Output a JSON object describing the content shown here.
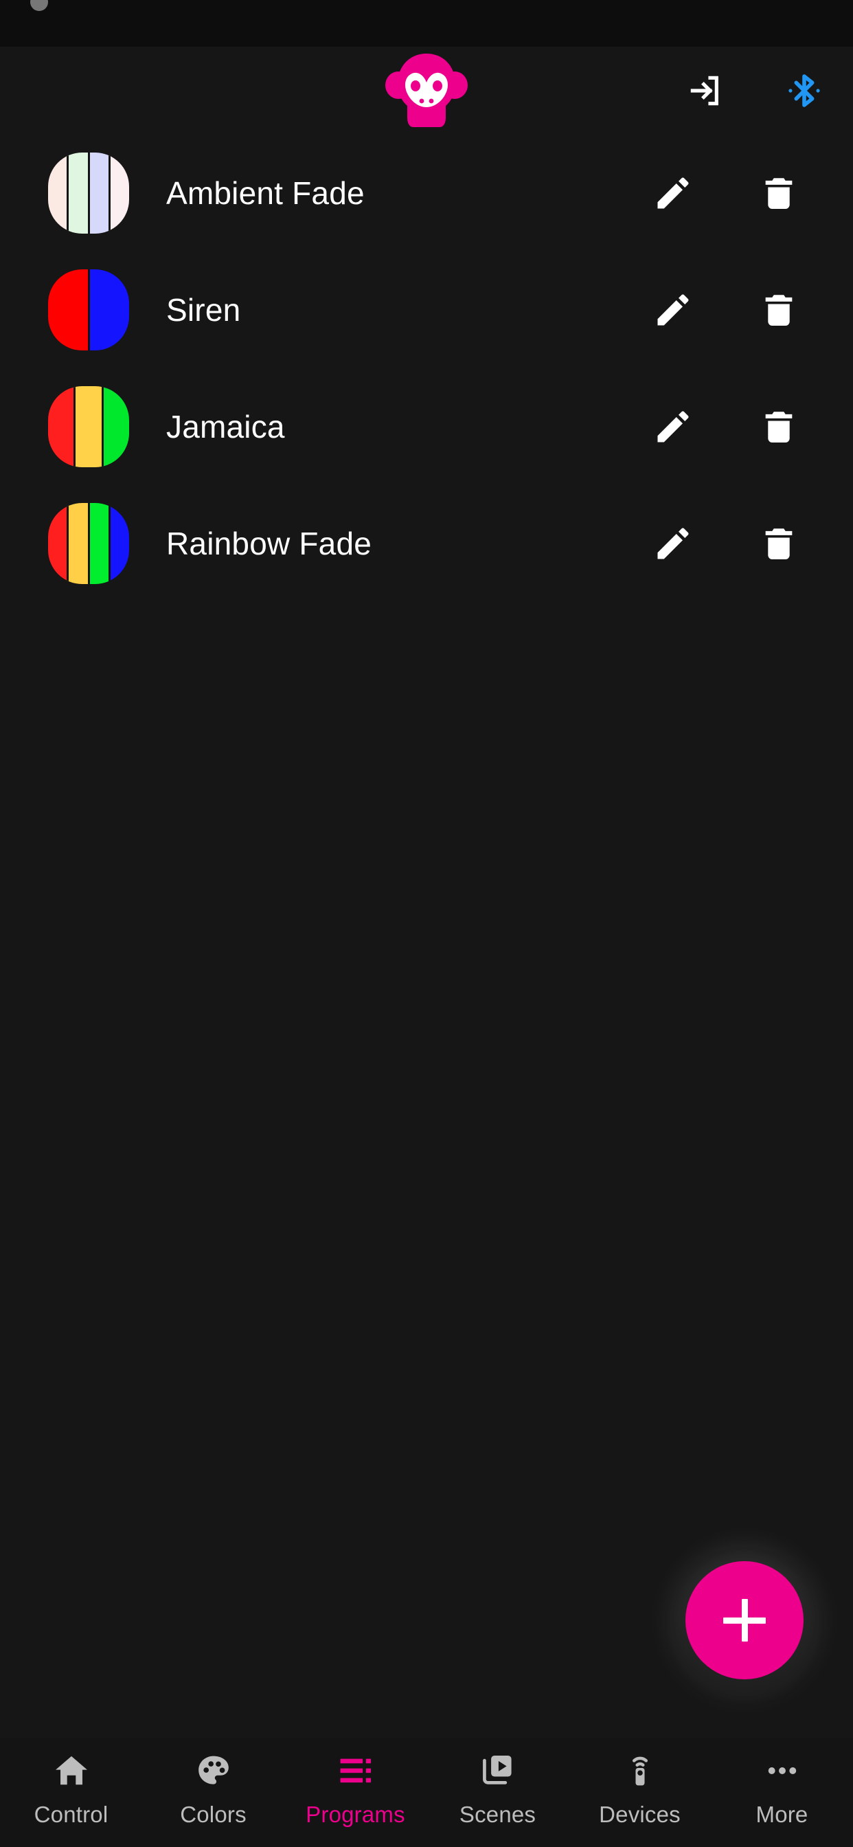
{
  "app": {
    "theme_background": "#161616",
    "status_bar_background": "#0d0d0d",
    "accent_color": "#EC008C",
    "bluetooth_color": "#2196F3",
    "brand_logo_name": "monkey-logo"
  },
  "app_bar": {
    "logo_alt": "Monkey brand logo",
    "actions": [
      {
        "name": "connect-icon",
        "label": "Connect"
      },
      {
        "name": "bluetooth-icon",
        "label": "Bluetooth"
      }
    ]
  },
  "programs": [
    {
      "name": "Ambient Fade",
      "colors": [
        "#FBEAE3",
        "#E0F6E1",
        "#D7D9FA",
        "#FBEFF1"
      ],
      "edit_label": "Edit",
      "delete_label": "Delete"
    },
    {
      "name": "Siren",
      "colors": [
        "#FF0000",
        "#1414FF"
      ],
      "edit_label": "Edit",
      "delete_label": "Delete"
    },
    {
      "name": "Jamaica",
      "colors": [
        "#FF1F1F",
        "#FFD24A",
        "#00E82B"
      ],
      "edit_label": "Edit",
      "delete_label": "Delete"
    },
    {
      "name": "Rainbow Fade",
      "colors": [
        "#FF1F1F",
        "#FFCF47",
        "#00EE2E",
        "#1414FF"
      ],
      "edit_label": "Edit",
      "delete_label": "Delete"
    }
  ],
  "fab": {
    "label": "+",
    "action_name": "add-program",
    "color": "#EC008C"
  },
  "bottom_nav": {
    "active_index": 2,
    "items": [
      {
        "label": "Control",
        "icon": "home-icon"
      },
      {
        "label": "Colors",
        "icon": "palette-icon"
      },
      {
        "label": "Programs",
        "icon": "playlist-icon"
      },
      {
        "label": "Scenes",
        "icon": "video-library-icon"
      },
      {
        "label": "Devices",
        "icon": "remote-control-icon"
      },
      {
        "label": "More",
        "icon": "more-horizontal-icon"
      }
    ]
  }
}
